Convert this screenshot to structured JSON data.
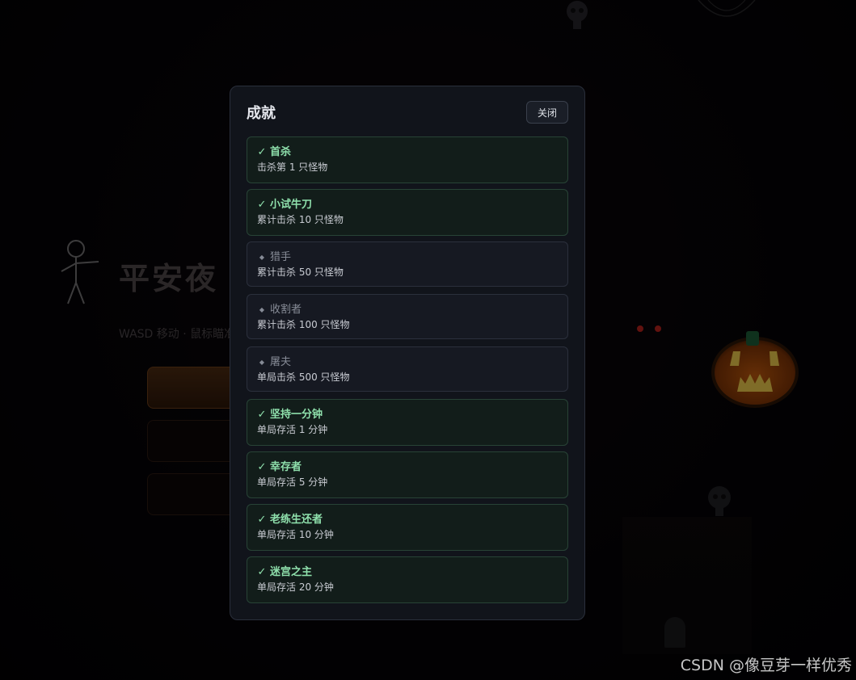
{
  "background": {
    "title": "平安夜",
    "subtitle": "WASD 移动 · 鼠标瞄准"
  },
  "modal": {
    "title": "成就",
    "close_label": "关闭",
    "achievements": [
      {
        "name": "首杀",
        "desc": "击杀第 1 只怪物",
        "done": true,
        "icon": "✓"
      },
      {
        "name": "小试牛刀",
        "desc": "累计击杀 10 只怪物",
        "done": true,
        "icon": "✓"
      },
      {
        "name": "猎手",
        "desc": "累计击杀 50 只怪物",
        "done": false,
        "icon": "◆"
      },
      {
        "name": "收割者",
        "desc": "累计击杀 100 只怪物",
        "done": false,
        "icon": "◆"
      },
      {
        "name": "屠夫",
        "desc": "单局击杀 500 只怪物",
        "done": false,
        "icon": "◆"
      },
      {
        "name": "坚持一分钟",
        "desc": "单局存活 1 分钟",
        "done": true,
        "icon": "✓"
      },
      {
        "name": "幸存者",
        "desc": "单局存活 5 分钟",
        "done": true,
        "icon": "✓"
      },
      {
        "name": "老练生还者",
        "desc": "单局存活 10 分钟",
        "done": true,
        "icon": "✓"
      },
      {
        "name": "迷宫之主",
        "desc": "单局存活 20 分钟",
        "done": true,
        "icon": "✓"
      }
    ]
  },
  "watermark": "CSDN @像豆芽一样优秀",
  "colors": {
    "modal_bg": "#11141b",
    "done_text": "#8fe0ac",
    "locked_text": "#868b96"
  }
}
